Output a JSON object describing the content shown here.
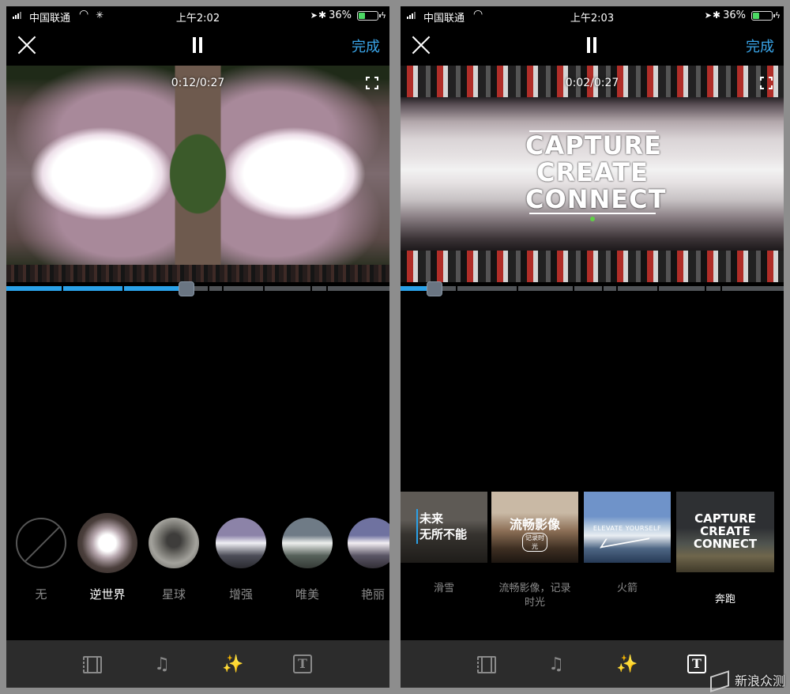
{
  "left": {
    "status": {
      "carrier": "中国联通",
      "time": "上午2:02",
      "battery": "36%"
    },
    "header": {
      "done": "完成"
    },
    "player": {
      "timecode": "0:12/0:27",
      "progress_fraction": 0.47
    },
    "filters": [
      {
        "label": "无",
        "thumb": "none"
      },
      {
        "label": "逆世界",
        "thumb": "t1",
        "selected": true
      },
      {
        "label": "星球",
        "thumb": "t2"
      },
      {
        "label": "增强",
        "thumb": "t3"
      },
      {
        "label": "唯美",
        "thumb": "t4"
      },
      {
        "label": "艳丽",
        "thumb": "t5"
      }
    ],
    "toolbar_active": "effects"
  },
  "right": {
    "status": {
      "carrier": "中国联通",
      "time": "上午2:03",
      "battery": "36%"
    },
    "header": {
      "done": "完成"
    },
    "player": {
      "timecode": "0:02/0:27",
      "progress_fraction": 0.08,
      "overlay_lines": [
        "CAPTURE",
        "CREATE",
        "CONNECT"
      ]
    },
    "themes": [
      {
        "label": "滑雪",
        "card_text": "未来\n无所不能"
      },
      {
        "label": "流畅影像，记录时光",
        "card_text": "流畅影像",
        "card_sub": "记录时光"
      },
      {
        "label": "火箭",
        "card_text": "ELEVATE YOURSELF"
      },
      {
        "label": "奔跑",
        "card_text": "CAPTURE\nCREATE\nCONNECT",
        "selected": true
      }
    ],
    "toolbar_active": "text"
  },
  "toolbar": {
    "text_glyph": "T",
    "music_glyph": "♫",
    "effects_glyph": "✨"
  },
  "watermark": {
    "text": "新浪众测"
  },
  "colors": {
    "accent": "#2aa1e8",
    "background": "#000000",
    "toolbar": "#2c2c2c"
  }
}
